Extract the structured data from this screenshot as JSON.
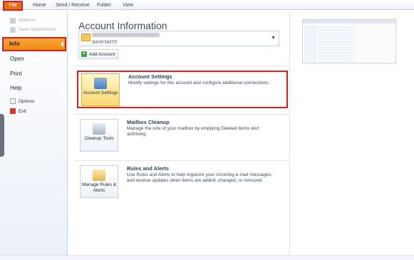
{
  "ribbon": {
    "file_tab": "File",
    "tabs": [
      "Home",
      "Send / Receive",
      "Folder",
      "View"
    ]
  },
  "left_pane": {
    "top_commands": [
      {
        "label": "Save As",
        "icon": "save-as-icon"
      },
      {
        "label": "Save Attachments",
        "icon": "save-attachments-icon"
      }
    ],
    "info": "Info",
    "nav": [
      "Open",
      "Print",
      "Help"
    ],
    "sub_commands": [
      {
        "label": "Options",
        "icon": "options-icon"
      },
      {
        "label": "Exit",
        "icon": "exit-icon"
      }
    ]
  },
  "main": {
    "title": "Account Information",
    "account": {
      "type": "IMAP/SMTP"
    },
    "add_account": "Add Account",
    "sections": [
      {
        "button": "Account Settings",
        "icon": "account-settings-icon",
        "title": "Account Settings",
        "description": "Modify settings for this account and configure additional connections."
      },
      {
        "button": "Cleanup Tools",
        "icon": "cleanup-tools-icon",
        "title": "Mailbox Cleanup",
        "description": "Manage the size of your mailbox by emptying Deleted Items and archiving."
      },
      {
        "button": "Manage Rules & Alerts",
        "icon": "rules-alerts-icon",
        "title": "Rules and Alerts",
        "description": "Use Rules and Alerts to help organize your incoming e-mail messages, and receive updates when items are added, changed, or removed."
      }
    ]
  },
  "colors": {
    "accent_orange": "#f08a10",
    "highlight_red": "#d92020",
    "title_blue": "#3b4a5e"
  }
}
